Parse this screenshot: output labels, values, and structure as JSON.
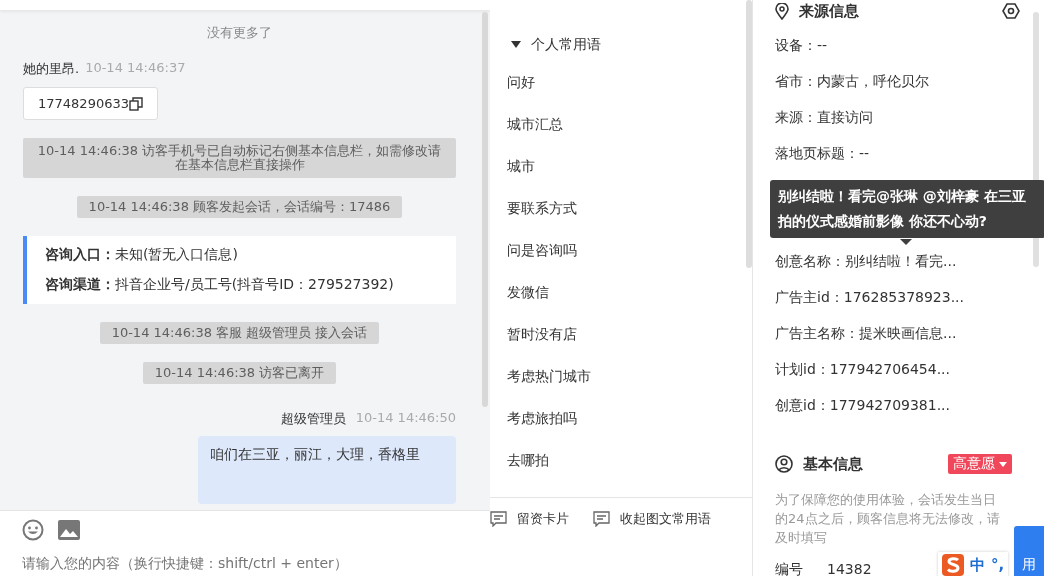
{
  "chat": {
    "end_notice": "没有更多了",
    "messages": [
      {
        "kind": "visitor",
        "sender": "她的里昂.",
        "time": "10-14 14:46:37",
        "text": "17748290633"
      },
      {
        "kind": "system",
        "text": "10-14 14:46:38 访客手机号已自动标记右侧基本信息栏，如需修改请在基本信息栏直接操作"
      },
      {
        "kind": "system",
        "text": "10-14 14:46:38 顾客发起会话，会话编号：17486"
      },
      {
        "kind": "info",
        "rows": [
          {
            "label": "咨询入口：",
            "value": "未知(暂无入口信息)"
          },
          {
            "label": "咨询渠道：",
            "value": "抖音企业号/员工号(抖音号ID：279527392)"
          }
        ]
      },
      {
        "kind": "system",
        "text": "10-14 14:46:38 客服 超级管理员 接入会话"
      },
      {
        "kind": "system",
        "text": "10-14 14:46:38 访客已离开"
      },
      {
        "kind": "agent",
        "sender": "超级管理员",
        "time": "10-14 14:46:50",
        "text": "咱们在三亚，丽江，大理，香格里"
      }
    ]
  },
  "composer": {
    "placeholder": "请输入您的内容（换行快捷键：shift/ctrl + enter）"
  },
  "phrases": {
    "group": {
      "title": "个人常用语",
      "expanded": true
    },
    "items": [
      "问好",
      "城市汇总",
      "城市",
      "要联系方式",
      "问是咨询吗",
      "发微信",
      "暂时没有店",
      "考虑热门城市",
      "考虑旅拍吗",
      "去哪拍"
    ],
    "actions": [
      "留资卡片",
      "收起图文常用语"
    ]
  },
  "source_info": {
    "title": "来源信息",
    "fields": [
      {
        "label": "设备：",
        "value": "--"
      },
      {
        "label": "省市：",
        "value": "内蒙古，呼伦贝尔"
      },
      {
        "label": "来源：",
        "value": "直接访问"
      },
      {
        "label": "落地页标题：",
        "value": "--"
      },
      {
        "kind": "hidden"
      },
      {
        "label": "创意名称：",
        "value": "别纠结啦！看完..."
      },
      {
        "label": "广告主id：",
        "value": "176285378923..."
      },
      {
        "label": "广告主名称：",
        "value": "提米映画信息..."
      },
      {
        "label": "计划id：",
        "value": "177942706454..."
      },
      {
        "label": "创意id：",
        "value": "177942709381..."
      }
    ],
    "tooltip": "别纠结啦！看完@张琳 @刘梓豪 在三亚拍的仪式感婚前影像 你还不心动?"
  },
  "basic_info": {
    "title": "基本信息",
    "intent_tag": "高意愿",
    "notice": "为了保障您的使用体验，会话发生当日的24点之后，顾客信息将无法修改，请及时填写",
    "fields": [
      {
        "label": "编号",
        "value": "14382"
      }
    ]
  },
  "ime": {
    "mode": "中",
    "punct": "°,",
    "button": "用"
  }
}
